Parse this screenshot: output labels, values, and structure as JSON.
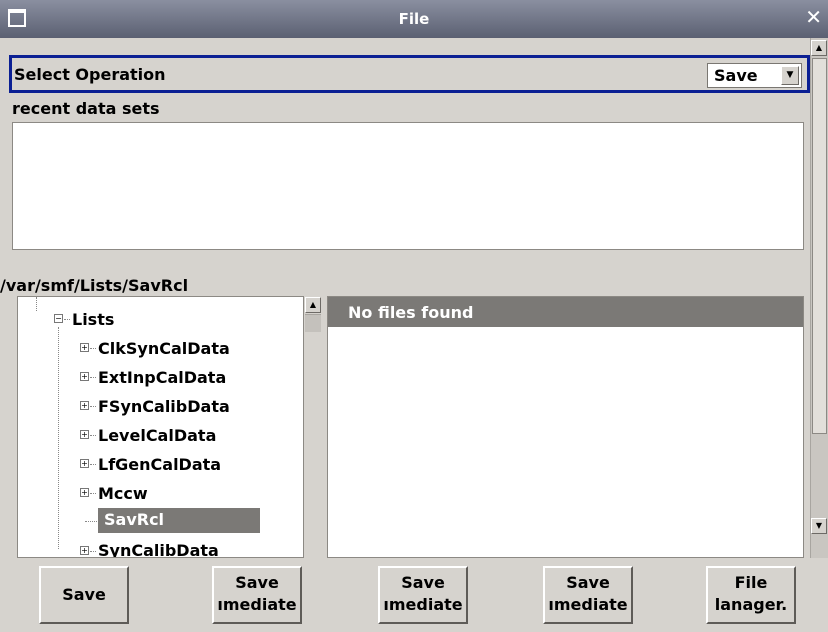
{
  "window": {
    "title": "File"
  },
  "select_operation": {
    "label": "Select Operation",
    "value": "Save"
  },
  "recent": {
    "label": "recent data sets"
  },
  "path": "/var/smf/Lists/SavRcl",
  "tree": {
    "root_label": "Lists",
    "items": [
      "ClkSynCalData",
      "ExtInpCalData",
      "FSynCalibData",
      "LevelCalData",
      "LfGenCalData",
      "Mccw",
      "SavRcl",
      "SynCalibData"
    ],
    "selected": "SavRcl"
  },
  "files": {
    "header": "No files found"
  },
  "buttons": {
    "save": "Save",
    "save_immediate_1": [
      "Save",
      "ımediate"
    ],
    "save_immediate_2": [
      "Save",
      "ımediate"
    ],
    "save_immediate_3": [
      "Save",
      "ımediate"
    ],
    "file_manager": [
      "File",
      "lanager."
    ]
  },
  "icons": {
    "window_menu": "window-menu-icon",
    "close": "close-icon",
    "expand": "plus-box-icon",
    "collapse": "minus-box-icon"
  },
  "colors": {
    "focus_border": "#0b1f93",
    "selection": "#7b7976"
  }
}
